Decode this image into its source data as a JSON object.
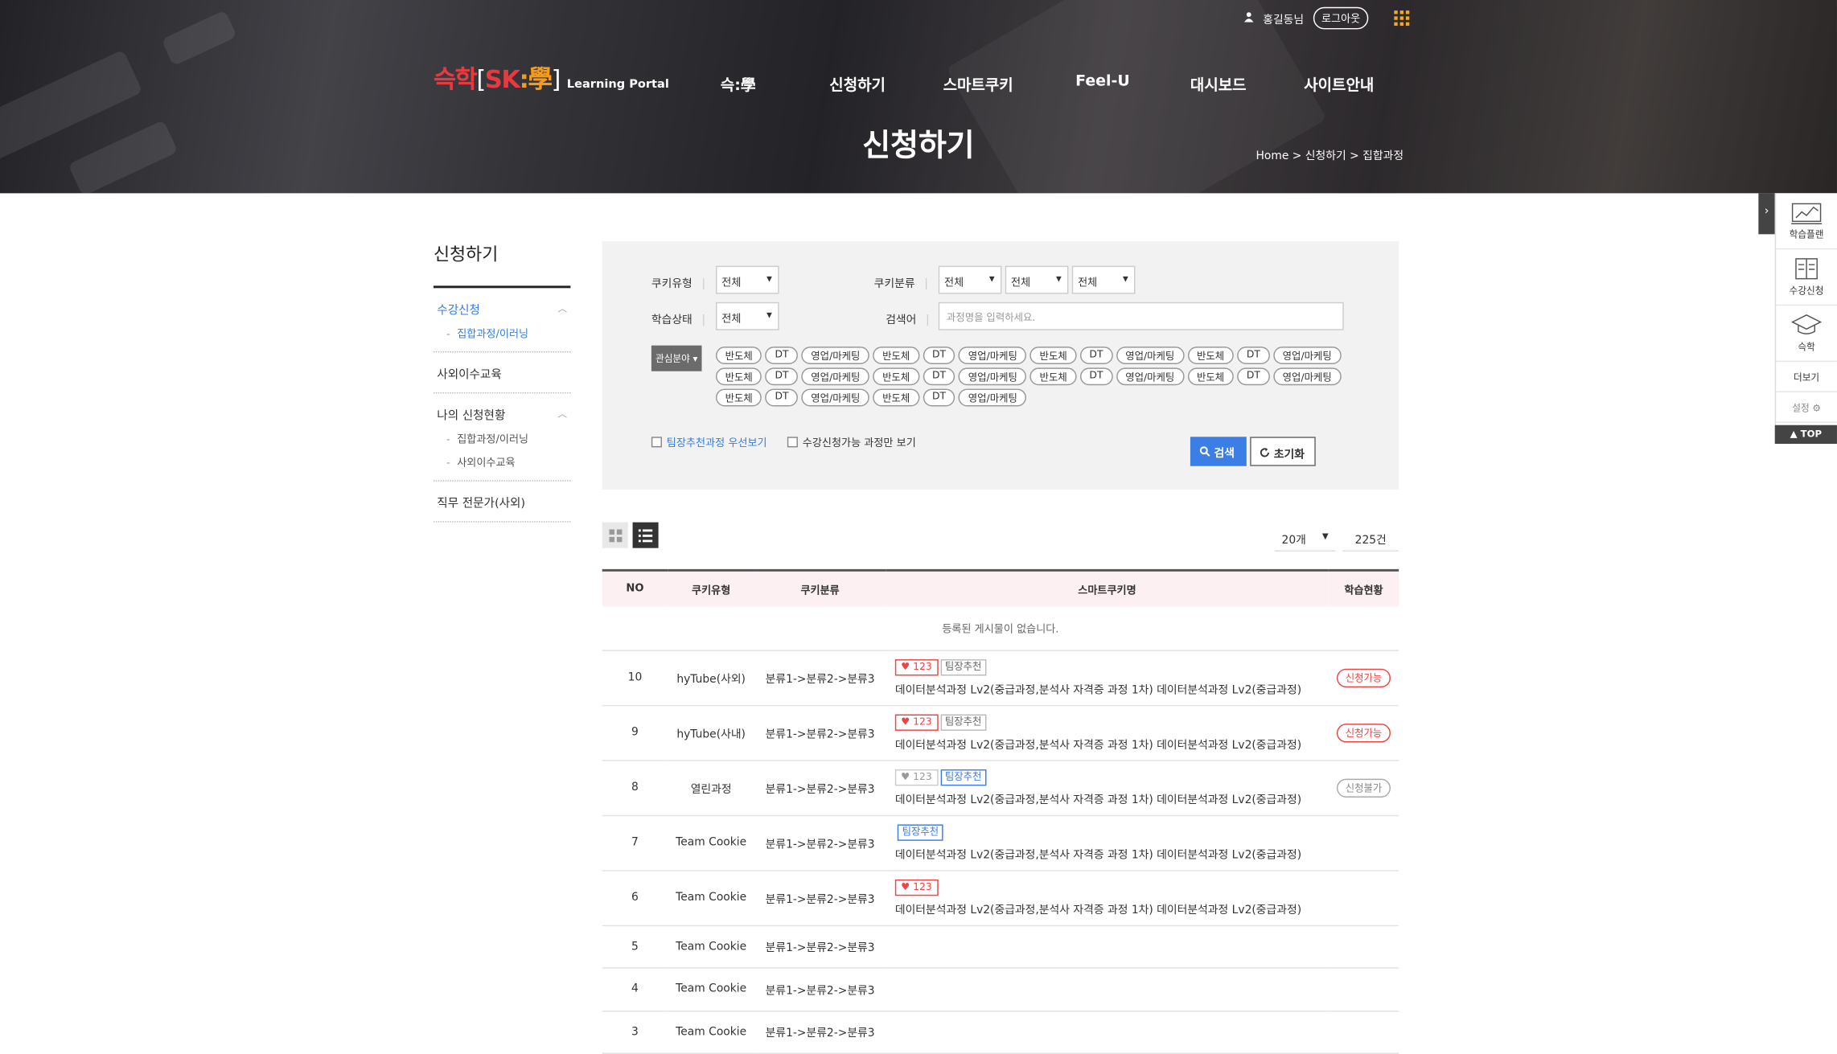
{
  "header": {
    "logo": {
      "main1": "슥학",
      "br_open": "[",
      "sk": "SK",
      "colon": ":",
      "hak": "學",
      "br_close": "]",
      "sub": "Learning Portal"
    },
    "user": {
      "name": "홍길동님",
      "logout": "로그아웃"
    },
    "nav": [
      "슥:學",
      "신청하기",
      "스마트쿠키",
      "Feel-U",
      "대시보드",
      "사이트안내"
    ],
    "page_title": "신청하기",
    "breadcrumb": {
      "home": "Home",
      "sep": ">",
      "level1": "신청하기",
      "level2": "집합과정"
    }
  },
  "lnb": {
    "title": "신청하기",
    "groups": [
      {
        "label": "수강신청",
        "sub": [
          "집합과정/이러닝"
        ]
      },
      {
        "label": "사외이수교육",
        "sub": []
      },
      {
        "label": "나의 신청현황",
        "sub": [
          "집합과정/이러닝",
          "사외이수교육"
        ]
      },
      {
        "label": "직무 전문가(사외)",
        "sub": []
      }
    ]
  },
  "filter": {
    "cookie_type_label": "쿠키유형",
    "cookie_type_value": "전체",
    "cookie_cat_label": "쿠키분류",
    "cookie_cat_values": [
      "전체",
      "전체",
      "전체"
    ],
    "status_label": "학습상태",
    "status_value": "전체",
    "keyword_label": "검색어",
    "keyword_placeholder": "과정명을 입력하세요.",
    "interest_button": "관심분야 ▾",
    "tags": [
      "반도체",
      "DT",
      "영업/마케팅",
      "반도체",
      "DT",
      "영업/마케팅",
      "반도체",
      "DT",
      "영업/마케팅",
      "반도체",
      "DT",
      "영업/마케팅",
      "반도체",
      "DT",
      "영업/마케팅",
      "반도체",
      "DT",
      "영업/마케팅",
      "반도체",
      "DT",
      "영업/마케팅",
      "반도체",
      "DT",
      "영업/마케팅",
      "반도체",
      "DT",
      "영업/마케팅",
      "반도체",
      "DT",
      "영업/마케팅"
    ],
    "check_team": "팀장추천과정 우선보기",
    "check_avail": "수강신청가능 과정만 보기",
    "search_btn": "검색",
    "reset_btn": "초기화"
  },
  "list": {
    "page_size": "20개",
    "total": "225건",
    "headers": [
      "NO",
      "쿠키유형",
      "쿠키분류",
      "스마트쿠키명",
      "학습현황"
    ],
    "empty": "등록된 게시물이 없습니다.",
    "rows": [
      {
        "no": "10",
        "type": "hyTube(사외)",
        "cat": "분류1->분류2->분류3",
        "like": "123",
        "rec": "팀장추천",
        "title": "데이터분석과정 Lv2(중급과정,분석사 자격증 과정 1차) 데이터분석과정 Lv2(중급과정)",
        "status": "신청가능"
      },
      {
        "no": "9",
        "type": "hyTube(사내)",
        "cat": "분류1->분류2->분류3",
        "like": "123",
        "rec": "팀장추천",
        "title": "데이터분석과정 Lv2(중급과정,분석사 자격증 과정 1차) 데이터분석과정 Lv2(중급과정)",
        "status": "신청가능"
      },
      {
        "no": "8",
        "type": "열린과정",
        "cat": "분류1->분류2->분류3",
        "like": "123",
        "rec": "팀장추천",
        "title": "데이터분석과정 Lv2(중급과정,분석사 자격증 과정 1차) 데이터분석과정 Lv2(중급과정)",
        "status": "신청불가"
      },
      {
        "no": "7",
        "type": "Team Cookie",
        "cat": "분류1->분류2->분류3",
        "rec": "팀장추천",
        "title": "데이터분석과정 Lv2(중급과정,분석사 자격증 과정 1차) 데이터분석과정 Lv2(중급과정)"
      },
      {
        "no": "6",
        "type": "Team Cookie",
        "cat": "분류1->분류2->분류3",
        "like": "123",
        "title": "데이터분석과정 Lv2(중급과정,분석사 자격증 과정 1차) 데이터분석과정 Lv2(중급과정)"
      },
      {
        "no": "5",
        "type": "Team Cookie",
        "cat": "분류1->분류2->분류3"
      },
      {
        "no": "4",
        "type": "Team Cookie",
        "cat": "분류1->분류2->분류3"
      },
      {
        "no": "3",
        "type": "Team Cookie",
        "cat": "분류1->분류2->분류3"
      }
    ]
  },
  "quick": {
    "items": [
      "학습플랜",
      "수강신청",
      "슥학",
      "더보기",
      "설정 ⚙"
    ],
    "top": "▲ TOP"
  },
  "colors": {
    "accent_blue": "#3a7ee6",
    "brand_red": "#e53a3f",
    "brand_orange": "#f59b1c",
    "status_red": "#e44444"
  }
}
